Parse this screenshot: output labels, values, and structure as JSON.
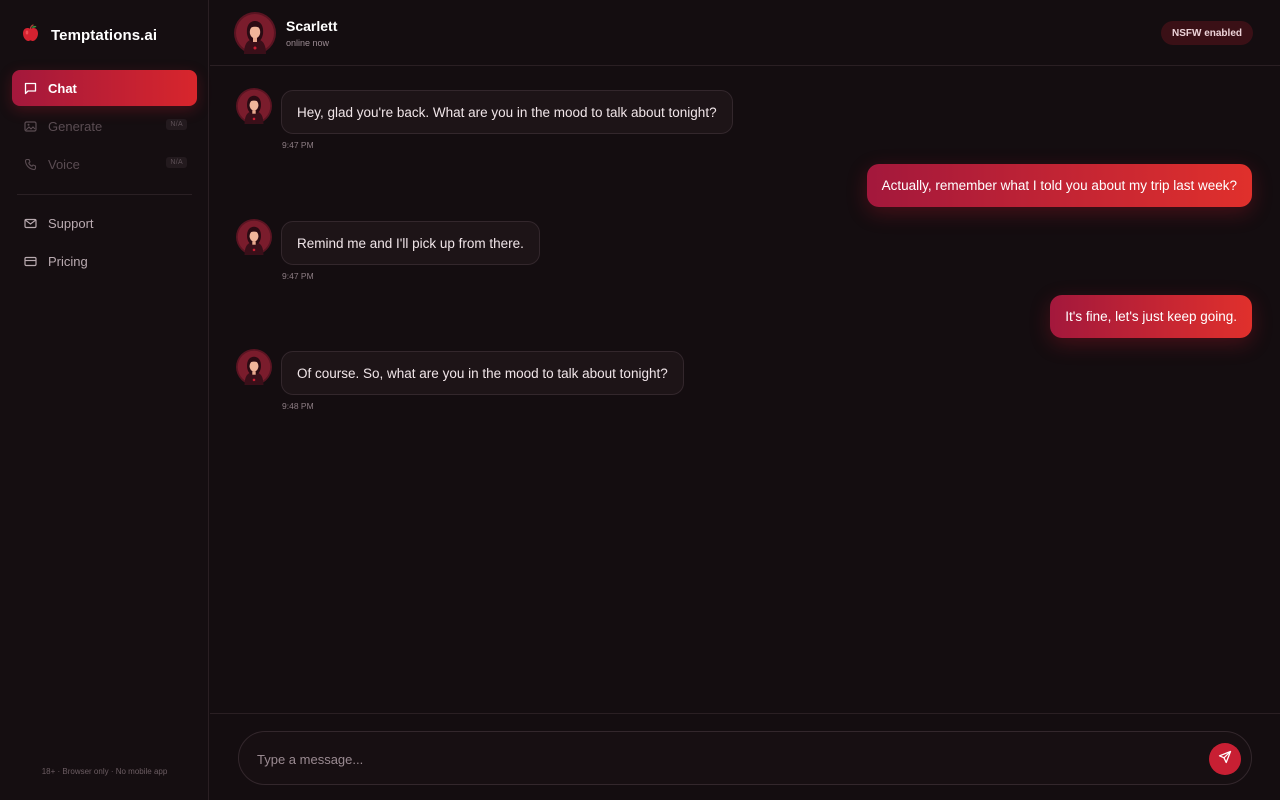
{
  "brand": {
    "name": "Temptations.ai",
    "icon": "apple-icon"
  },
  "nav": {
    "items": [
      {
        "label": "Chat",
        "icon": "chat-icon",
        "active": true
      },
      {
        "label": "Generate",
        "icon": "image-icon",
        "badge": "N/A",
        "disabled": true
      },
      {
        "label": "Voice",
        "icon": "phone-icon",
        "badge": "N/A",
        "disabled": true
      }
    ],
    "secondary": [
      {
        "label": "Support",
        "icon": "mail-icon"
      },
      {
        "label": "Pricing",
        "icon": "card-icon"
      }
    ]
  },
  "footer": {
    "text": "18+ · Browser only · No mobile app"
  },
  "header": {
    "name": "Scarlett",
    "status": "online now",
    "badge": "NSFW enabled"
  },
  "messages": [
    {
      "from": "bot",
      "text": "Hey, glad you're back. What are you in the mood to talk about tonight?",
      "time": "9:47 PM"
    },
    {
      "from": "user",
      "text": "Actually, remember what I told you about my trip last week?"
    },
    {
      "from": "bot",
      "text": "Remind me and I'll pick up from there.",
      "time": "9:47 PM"
    },
    {
      "from": "user",
      "text": "It's fine, let's just keep going."
    },
    {
      "from": "bot",
      "text": "Of course. So, what are you in the mood to talk about tonight?",
      "time": "9:48 PM"
    }
  ],
  "composer": {
    "placeholder": "Type a message...",
    "send_icon": "send-icon"
  },
  "colors": {
    "accent": "#d8262c",
    "accent_dark": "#a3183c",
    "background": "#140d10"
  }
}
